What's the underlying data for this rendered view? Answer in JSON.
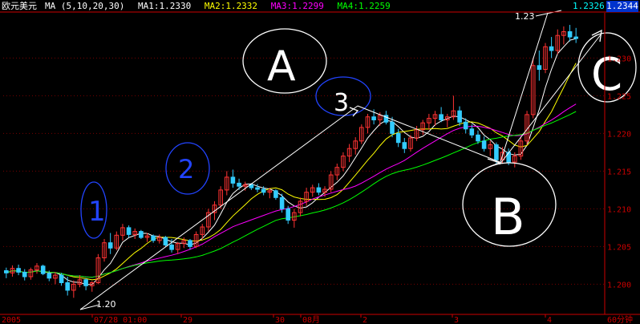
{
  "header": {
    "symbol": "欧元美元",
    "ma_params": "MA (5,10,20,30)",
    "ma1": "MA1:1.2330",
    "ma2": "MA2:1.2332",
    "ma3": "MA3:1.2299",
    "ma4": "MA4:1.2259",
    "last_price_label": "1.2326",
    "current_price_box": "1.2344"
  },
  "colors": {
    "background": "#000000",
    "up_candle": "#ff3333",
    "down_candle": "#33ccff",
    "ma1": "#ffffff",
    "ma2": "#ffff00",
    "ma3": "#ff00ff",
    "ma4": "#00ff00",
    "axis": "#cc0000",
    "grid": "#770000",
    "annotation": "#ffffff"
  },
  "annotations": {
    "label_a": "A",
    "label_b": "B",
    "label_c": "C",
    "mark_1": "1",
    "mark_2": "2",
    "mark_3": "3",
    "low_label": "1.20",
    "high_label": "1.23"
  },
  "chart_data": {
    "type": "candlestick",
    "title": "",
    "ylim": [
      1.196,
      1.236
    ],
    "y_ticks": [
      "1.230",
      "1.225",
      "1.220",
      "1.215",
      "1.210",
      "1.205",
      "1.200"
    ],
    "x_labels": [
      "2005",
      "07/28 01:00",
      "29",
      "30",
      "08月",
      "2",
      "3",
      "4",
      "60分钟"
    ],
    "series_names": [
      "MA1",
      "MA2",
      "MA3",
      "MA4"
    ],
    "ohlc": [
      [
        1.2018,
        1.2022,
        1.2008,
        1.2015
      ],
      [
        1.2015,
        1.2025,
        1.201,
        1.2021
      ],
      [
        1.2021,
        1.2026,
        1.2012,
        1.2016
      ],
      [
        1.2016,
        1.202,
        1.2005,
        1.201
      ],
      [
        1.201,
        1.2022,
        1.2006,
        1.2019
      ],
      [
        1.2019,
        1.2028,
        1.2014,
        1.2024
      ],
      [
        1.2024,
        1.2026,
        1.2012,
        1.2014
      ],
      [
        1.2014,
        1.2018,
        1.2004,
        1.2008
      ],
      [
        1.2008,
        1.2016,
        1.2,
        1.2012
      ],
      [
        1.2012,
        1.2015,
        1.1998,
        1.2002
      ],
      [
        1.2002,
        1.201,
        1.1985,
        1.1992
      ],
      [
        1.1992,
        1.2005,
        1.1982,
        1.2
      ],
      [
        1.2,
        1.2012,
        1.1996,
        1.2006
      ],
      [
        1.2006,
        1.2008,
        1.1992,
        1.1998
      ],
      [
        1.1998,
        1.2004,
        1.199,
        1.2002
      ],
      [
        1.2002,
        1.204,
        1.2,
        1.2035
      ],
      [
        1.2035,
        1.206,
        1.203,
        1.2055
      ],
      [
        1.2055,
        1.2068,
        1.204,
        1.2048
      ],
      [
        1.2048,
        1.207,
        1.2045,
        1.2065
      ],
      [
        1.2065,
        1.208,
        1.2058,
        1.2075
      ],
      [
        1.2075,
        1.2078,
        1.2062,
        1.2066
      ],
      [
        1.2066,
        1.2074,
        1.206,
        1.207
      ],
      [
        1.207,
        1.2072,
        1.206,
        1.2062
      ],
      [
        1.2062,
        1.2068,
        1.2056,
        1.2064
      ],
      [
        1.2064,
        1.2066,
        1.2055,
        1.2058
      ],
      [
        1.2058,
        1.2066,
        1.2054,
        1.2062
      ],
      [
        1.2062,
        1.2064,
        1.205,
        1.2052
      ],
      [
        1.2052,
        1.206,
        1.2042,
        1.2046
      ],
      [
        1.2046,
        1.2056,
        1.204,
        1.2054
      ],
      [
        1.2054,
        1.2062,
        1.2048,
        1.2058
      ],
      [
        1.2058,
        1.206,
        1.2046,
        1.205
      ],
      [
        1.205,
        1.207,
        1.2048,
        1.2066
      ],
      [
        1.2066,
        1.208,
        1.206,
        1.2076
      ],
      [
        1.2076,
        1.21,
        1.207,
        1.2095
      ],
      [
        1.2095,
        1.211,
        1.2085,
        1.2105
      ],
      [
        1.2105,
        1.213,
        1.21,
        1.2125
      ],
      [
        1.2125,
        1.215,
        1.2118,
        1.2142
      ],
      [
        1.2142,
        1.2152,
        1.2128,
        1.2134
      ],
      [
        1.2134,
        1.214,
        1.2125,
        1.213
      ],
      [
        1.213,
        1.2136,
        1.2124,
        1.2132
      ],
      [
        1.2132,
        1.2134,
        1.2125,
        1.2128
      ],
      [
        1.2128,
        1.2133,
        1.2122,
        1.2126
      ],
      [
        1.2126,
        1.213,
        1.2118,
        1.2122
      ],
      [
        1.2122,
        1.2128,
        1.2114,
        1.2124
      ],
      [
        1.2124,
        1.2126,
        1.2112,
        1.2115
      ],
      [
        1.2115,
        1.212,
        1.2095,
        1.21
      ],
      [
        1.21,
        1.2104,
        1.208,
        1.2085
      ],
      [
        1.2085,
        1.21,
        1.2075,
        1.2095
      ],
      [
        1.2095,
        1.2115,
        1.209,
        1.211
      ],
      [
        1.211,
        1.2128,
        1.2104,
        1.2122
      ],
      [
        1.2122,
        1.2132,
        1.2116,
        1.2128
      ],
      [
        1.2128,
        1.2134,
        1.2118,
        1.2122
      ],
      [
        1.2122,
        1.213,
        1.2116,
        1.2126
      ],
      [
        1.2126,
        1.215,
        1.2122,
        1.2145
      ],
      [
        1.2145,
        1.216,
        1.2138,
        1.2155
      ],
      [
        1.2155,
        1.2175,
        1.215,
        1.217
      ],
      [
        1.217,
        1.2186,
        1.2162,
        1.218
      ],
      [
        1.218,
        1.2195,
        1.2172,
        1.219
      ],
      [
        1.219,
        1.2212,
        1.2186,
        1.2208
      ],
      [
        1.2208,
        1.2226,
        1.22,
        1.2222
      ],
      [
        1.2222,
        1.2232,
        1.2212,
        1.2218
      ],
      [
        1.2218,
        1.2228,
        1.221,
        1.2224
      ],
      [
        1.2224,
        1.223,
        1.2212,
        1.2215
      ],
      [
        1.2215,
        1.2222,
        1.2195,
        1.22
      ],
      [
        1.22,
        1.2206,
        1.2182,
        1.2188
      ],
      [
        1.2188,
        1.2194,
        1.2174,
        1.218
      ],
      [
        1.218,
        1.2198,
        1.2176,
        1.2194
      ],
      [
        1.2194,
        1.221,
        1.219,
        1.2205
      ],
      [
        1.2205,
        1.2218,
        1.2198,
        1.2214
      ],
      [
        1.2214,
        1.2226,
        1.2205,
        1.222
      ],
      [
        1.222,
        1.223,
        1.221,
        1.2225
      ],
      [
        1.2225,
        1.2235,
        1.2215,
        1.2218
      ],
      [
        1.2218,
        1.2226,
        1.2208,
        1.2222
      ],
      [
        1.2222,
        1.225,
        1.2218,
        1.223
      ],
      [
        1.223,
        1.2236,
        1.221,
        1.2215
      ],
      [
        1.2215,
        1.222,
        1.22,
        1.2206
      ],
      [
        1.2206,
        1.2212,
        1.2194,
        1.2198
      ],
      [
        1.2198,
        1.2204,
        1.2186,
        1.219
      ],
      [
        1.219,
        1.2196,
        1.2176,
        1.218
      ],
      [
        1.218,
        1.219,
        1.217,
        1.2185
      ],
      [
        1.2185,
        1.2188,
        1.216,
        1.2165
      ],
      [
        1.2165,
        1.2182,
        1.216,
        1.2175
      ],
      [
        1.2175,
        1.218,
        1.2158,
        1.2162
      ],
      [
        1.2162,
        1.2175,
        1.2155,
        1.217
      ],
      [
        1.217,
        1.2195,
        1.2165,
        1.219
      ],
      [
        1.219,
        1.223,
        1.2185,
        1.2225
      ],
      [
        1.2225,
        1.23,
        1.222,
        1.229
      ],
      [
        1.229,
        1.231,
        1.227,
        1.2285
      ],
      [
        1.2285,
        1.232,
        1.228,
        1.2315
      ],
      [
        1.2315,
        1.2328,
        1.23,
        1.231
      ],
      [
        1.231,
        1.2338,
        1.2305,
        1.233
      ],
      [
        1.233,
        1.2342,
        1.2318,
        1.2335
      ],
      [
        1.2335,
        1.2344,
        1.2322,
        1.2328
      ],
      [
        1.2328,
        1.234,
        1.232,
        1.2326
      ]
    ]
  }
}
